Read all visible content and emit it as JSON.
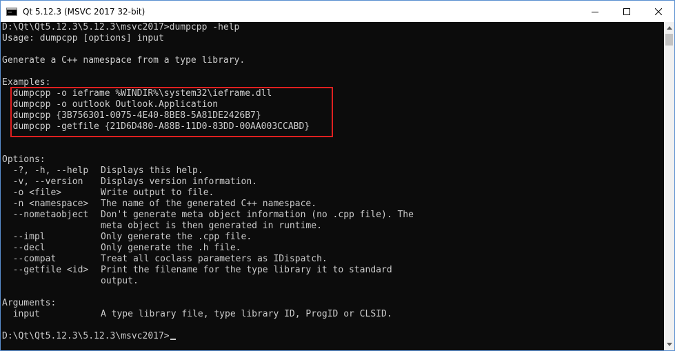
{
  "window": {
    "title": "Qt 5.12.3 (MSVC 2017 32-bit)"
  },
  "console": {
    "prompt_command": "D:\\Qt\\Qt5.12.3\\5.12.3\\msvc2017>dumpcpp -help",
    "usage": "Usage: dumpcpp [options] input",
    "description": "Generate a C++ namespace from a type library.",
    "examples_header": "Examples:",
    "examples": [
      "  dumpcpp -o ieframe %WINDIR%\\system32\\ieframe.dll",
      "  dumpcpp -o outlook Outlook.Application",
      "  dumpcpp {3B756301-0075-4E40-8BE8-5A81DE2426B7}",
      "  dumpcpp -getfile {21D6D480-A88B-11D0-83DD-00AA003CCABD}"
    ],
    "options_header": "Options:",
    "options": [
      {
        "flag": "  -?, -h, --help",
        "desc": "Displays this help."
      },
      {
        "flag": "  -v, --version",
        "desc": "Displays version information."
      },
      {
        "flag": "  -o <file>",
        "desc": "Write output to file."
      },
      {
        "flag": "  -n <namespace>",
        "desc": "The name of the generated C++ namespace."
      },
      {
        "flag": "  --nometaobject",
        "desc": "Don't generate meta object information (no .cpp file). The"
      },
      {
        "flag": "",
        "desc": "meta object is then generated in runtime."
      },
      {
        "flag": "  --impl",
        "desc": "Only generate the .cpp file."
      },
      {
        "flag": "  --decl",
        "desc": "Only generate the .h file."
      },
      {
        "flag": "  --compat",
        "desc": "Treat all coclass parameters as IDispatch."
      },
      {
        "flag": "  --getfile <id>",
        "desc": "Print the filename for the type library it to standard"
      },
      {
        "flag": "",
        "desc": "output."
      }
    ],
    "arguments_header": "Arguments:",
    "arguments": [
      {
        "name": "  input",
        "desc": "A type library file, type library ID, ProgID or CLSID."
      }
    ],
    "final_prompt": "D:\\Qt\\Qt5.12.3\\5.12.3\\msvc2017>"
  },
  "colors": {
    "console_bg": "#0c0c0c",
    "console_fg": "#cccccc",
    "highlight_border": "#e02020",
    "titlebar_bg": "#ffffff"
  },
  "icons": {
    "app": "console-icon",
    "minimize": "minimize-icon",
    "maximize": "maximize-icon",
    "close": "close-icon",
    "scroll_up": "scroll-up-arrow-icon",
    "scroll_down": "scroll-down-arrow-icon"
  }
}
